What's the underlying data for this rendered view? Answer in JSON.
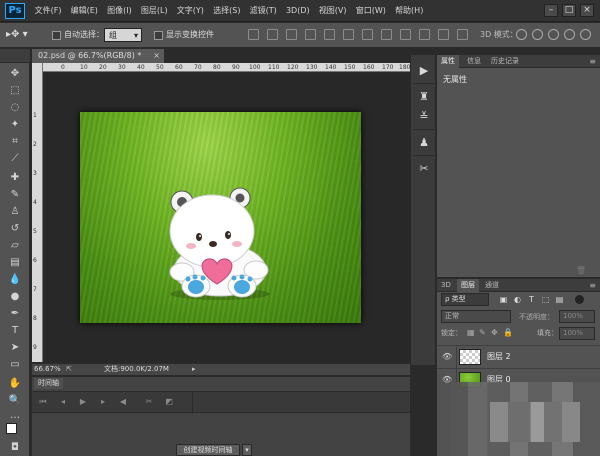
{
  "app": {
    "logo": "Ps"
  },
  "menu": [
    "文件(F)",
    "编辑(E)",
    "图像(I)",
    "图层(L)",
    "文字(Y)",
    "选择(S)",
    "滤镜(T)",
    "3D(D)",
    "视图(V)",
    "窗口(W)",
    "帮助(H)"
  ],
  "window_controls": {
    "minimize": "–",
    "restore": "□",
    "close": "×"
  },
  "options": {
    "auto_select_label": "自动选择：",
    "auto_select_value": "组",
    "show_transform_label": "显示变换控件",
    "mode_3d_label": "3D 模式："
  },
  "document": {
    "tab_title": "02.psd @ 66.7%(RGB/8) *",
    "zoom": "66.67%",
    "doc_info": "文档:900.0K/2.07M"
  },
  "ruler": {
    "top_ticks": [
      "0",
      "10",
      "20",
      "30",
      "40",
      "50",
      "60",
      "70",
      "80",
      "90",
      "100",
      "110",
      "120",
      "130",
      "140",
      "150",
      "160",
      "170",
      "180"
    ],
    "left_ticks": [
      "1",
      "2",
      "3",
      "4",
      "5",
      "6",
      "7",
      "8",
      "9"
    ]
  },
  "timeline": {
    "tab": "时间轴",
    "create_button": "创建视频时间轴",
    "dropdown": "▾"
  },
  "properties_panel": {
    "tabs": [
      "属性",
      "信息",
      "历史记录"
    ],
    "content": "无属性"
  },
  "layers_panel": {
    "tabs": [
      "3D",
      "图层",
      "通道"
    ],
    "filter": "ρ 类型",
    "blend_mode": "正常",
    "opacity_label": "不透明度：",
    "opacity_value": "100%",
    "lock_label": "锁定：",
    "fill_label": "填充：",
    "fill_value": "100%",
    "layers": [
      {
        "name": "图层 2",
        "thumb": "transparent"
      },
      {
        "name": "图层 0",
        "thumb": "grass"
      }
    ]
  }
}
